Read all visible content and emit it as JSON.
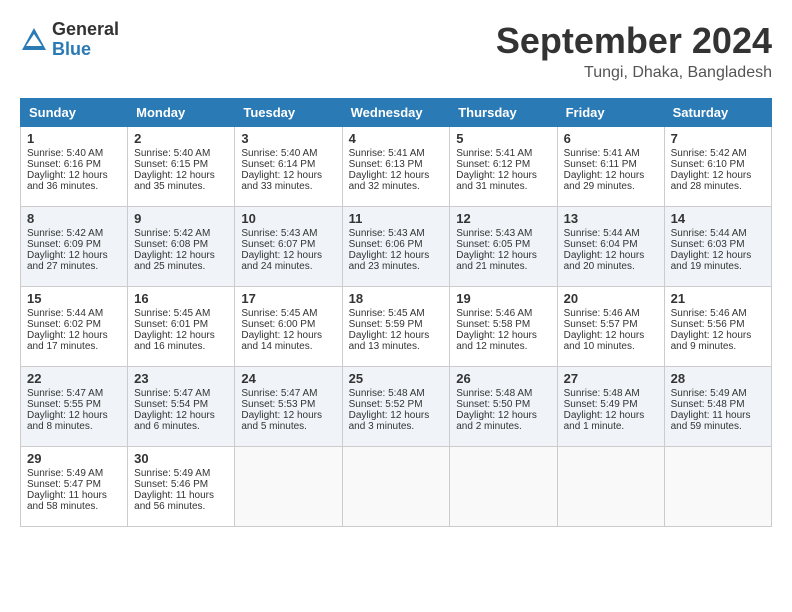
{
  "header": {
    "logo_general": "General",
    "logo_blue": "Blue",
    "month_year": "September 2024",
    "location": "Tungi, Dhaka, Bangladesh"
  },
  "days_of_week": [
    "Sunday",
    "Monday",
    "Tuesday",
    "Wednesday",
    "Thursday",
    "Friday",
    "Saturday"
  ],
  "weeks": [
    [
      {
        "day": "1",
        "sunrise": "Sunrise: 5:40 AM",
        "sunset": "Sunset: 6:16 PM",
        "daylight": "Daylight: 12 hours and 36 minutes."
      },
      {
        "day": "2",
        "sunrise": "Sunrise: 5:40 AM",
        "sunset": "Sunset: 6:15 PM",
        "daylight": "Daylight: 12 hours and 35 minutes."
      },
      {
        "day": "3",
        "sunrise": "Sunrise: 5:40 AM",
        "sunset": "Sunset: 6:14 PM",
        "daylight": "Daylight: 12 hours and 33 minutes."
      },
      {
        "day": "4",
        "sunrise": "Sunrise: 5:41 AM",
        "sunset": "Sunset: 6:13 PM",
        "daylight": "Daylight: 12 hours and 32 minutes."
      },
      {
        "day": "5",
        "sunrise": "Sunrise: 5:41 AM",
        "sunset": "Sunset: 6:12 PM",
        "daylight": "Daylight: 12 hours and 31 minutes."
      },
      {
        "day": "6",
        "sunrise": "Sunrise: 5:41 AM",
        "sunset": "Sunset: 6:11 PM",
        "daylight": "Daylight: 12 hours and 29 minutes."
      },
      {
        "day": "7",
        "sunrise": "Sunrise: 5:42 AM",
        "sunset": "Sunset: 6:10 PM",
        "daylight": "Daylight: 12 hours and 28 minutes."
      }
    ],
    [
      {
        "day": "8",
        "sunrise": "Sunrise: 5:42 AM",
        "sunset": "Sunset: 6:09 PM",
        "daylight": "Daylight: 12 hours and 27 minutes."
      },
      {
        "day": "9",
        "sunrise": "Sunrise: 5:42 AM",
        "sunset": "Sunset: 6:08 PM",
        "daylight": "Daylight: 12 hours and 25 minutes."
      },
      {
        "day": "10",
        "sunrise": "Sunrise: 5:43 AM",
        "sunset": "Sunset: 6:07 PM",
        "daylight": "Daylight: 12 hours and 24 minutes."
      },
      {
        "day": "11",
        "sunrise": "Sunrise: 5:43 AM",
        "sunset": "Sunset: 6:06 PM",
        "daylight": "Daylight: 12 hours and 23 minutes."
      },
      {
        "day": "12",
        "sunrise": "Sunrise: 5:43 AM",
        "sunset": "Sunset: 6:05 PM",
        "daylight": "Daylight: 12 hours and 21 minutes."
      },
      {
        "day": "13",
        "sunrise": "Sunrise: 5:44 AM",
        "sunset": "Sunset: 6:04 PM",
        "daylight": "Daylight: 12 hours and 20 minutes."
      },
      {
        "day": "14",
        "sunrise": "Sunrise: 5:44 AM",
        "sunset": "Sunset: 6:03 PM",
        "daylight": "Daylight: 12 hours and 19 minutes."
      }
    ],
    [
      {
        "day": "15",
        "sunrise": "Sunrise: 5:44 AM",
        "sunset": "Sunset: 6:02 PM",
        "daylight": "Daylight: 12 hours and 17 minutes."
      },
      {
        "day": "16",
        "sunrise": "Sunrise: 5:45 AM",
        "sunset": "Sunset: 6:01 PM",
        "daylight": "Daylight: 12 hours and 16 minutes."
      },
      {
        "day": "17",
        "sunrise": "Sunrise: 5:45 AM",
        "sunset": "Sunset: 6:00 PM",
        "daylight": "Daylight: 12 hours and 14 minutes."
      },
      {
        "day": "18",
        "sunrise": "Sunrise: 5:45 AM",
        "sunset": "Sunset: 5:59 PM",
        "daylight": "Daylight: 12 hours and 13 minutes."
      },
      {
        "day": "19",
        "sunrise": "Sunrise: 5:46 AM",
        "sunset": "Sunset: 5:58 PM",
        "daylight": "Daylight: 12 hours and 12 minutes."
      },
      {
        "day": "20",
        "sunrise": "Sunrise: 5:46 AM",
        "sunset": "Sunset: 5:57 PM",
        "daylight": "Daylight: 12 hours and 10 minutes."
      },
      {
        "day": "21",
        "sunrise": "Sunrise: 5:46 AM",
        "sunset": "Sunset: 5:56 PM",
        "daylight": "Daylight: 12 hours and 9 minutes."
      }
    ],
    [
      {
        "day": "22",
        "sunrise": "Sunrise: 5:47 AM",
        "sunset": "Sunset: 5:55 PM",
        "daylight": "Daylight: 12 hours and 8 minutes."
      },
      {
        "day": "23",
        "sunrise": "Sunrise: 5:47 AM",
        "sunset": "Sunset: 5:54 PM",
        "daylight": "Daylight: 12 hours and 6 minutes."
      },
      {
        "day": "24",
        "sunrise": "Sunrise: 5:47 AM",
        "sunset": "Sunset: 5:53 PM",
        "daylight": "Daylight: 12 hours and 5 minutes."
      },
      {
        "day": "25",
        "sunrise": "Sunrise: 5:48 AM",
        "sunset": "Sunset: 5:52 PM",
        "daylight": "Daylight: 12 hours and 3 minutes."
      },
      {
        "day": "26",
        "sunrise": "Sunrise: 5:48 AM",
        "sunset": "Sunset: 5:50 PM",
        "daylight": "Daylight: 12 hours and 2 minutes."
      },
      {
        "day": "27",
        "sunrise": "Sunrise: 5:48 AM",
        "sunset": "Sunset: 5:49 PM",
        "daylight": "Daylight: 12 hours and 1 minute."
      },
      {
        "day": "28",
        "sunrise": "Sunrise: 5:49 AM",
        "sunset": "Sunset: 5:48 PM",
        "daylight": "Daylight: 11 hours and 59 minutes."
      }
    ],
    [
      {
        "day": "29",
        "sunrise": "Sunrise: 5:49 AM",
        "sunset": "Sunset: 5:47 PM",
        "daylight": "Daylight: 11 hours and 58 minutes."
      },
      {
        "day": "30",
        "sunrise": "Sunrise: 5:49 AM",
        "sunset": "Sunset: 5:46 PM",
        "daylight": "Daylight: 11 hours and 56 minutes."
      },
      {
        "day": "",
        "sunrise": "",
        "sunset": "",
        "daylight": ""
      },
      {
        "day": "",
        "sunrise": "",
        "sunset": "",
        "daylight": ""
      },
      {
        "day": "",
        "sunrise": "",
        "sunset": "",
        "daylight": ""
      },
      {
        "day": "",
        "sunrise": "",
        "sunset": "",
        "daylight": ""
      },
      {
        "day": "",
        "sunrise": "",
        "sunset": "",
        "daylight": ""
      }
    ]
  ]
}
